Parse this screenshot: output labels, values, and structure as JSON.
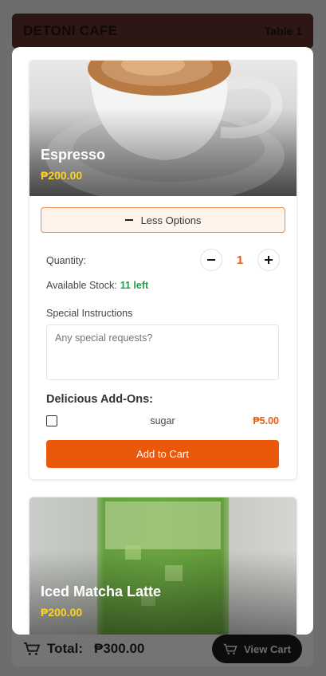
{
  "background": {
    "brand": "DETONI CAFE",
    "table": "Table 1",
    "total_label": "Total:",
    "total_amount": "₱300.00",
    "view_cart_label": "View Cart"
  },
  "items": [
    {
      "name": "Espresso",
      "price": "₱200.00",
      "options_toggle_label": "Less Options",
      "quantity_label": "Quantity:",
      "quantity_value": "1",
      "stock_label": "Available Stock:",
      "stock_value": "11 left",
      "special_instructions_label": "Special Instructions",
      "special_instructions_placeholder": "Any special requests?",
      "addons_title": "Delicious Add-Ons:",
      "addons": [
        {
          "name": "sugar",
          "price": "₱5.00",
          "checked": false
        }
      ],
      "add_to_cart_label": "Add to Cart"
    },
    {
      "name": "Iced Matcha Latte",
      "price": "₱200.00"
    }
  ],
  "colors": {
    "accent": "#ea580c",
    "price_yellow": "#ffd21f",
    "stock_green": "#1aa34a"
  }
}
